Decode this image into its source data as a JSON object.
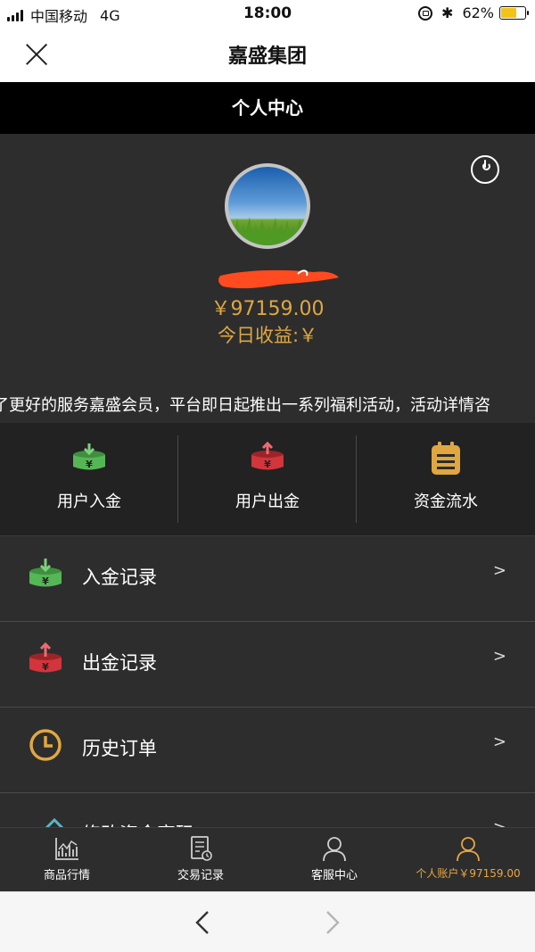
{
  "status_bar": {
    "carrier": "中国移动",
    "network": "4G",
    "time": "18:00",
    "battery": "62%",
    "battery_level": 0.62,
    "battery_color": "#f2c418"
  },
  "nav": {
    "title": "嘉盛集团",
    "close_icon": "close-icon"
  },
  "page_header": {
    "title": "个人中心"
  },
  "profile": {
    "balance": "￥97159.00",
    "today_earnings": "今日收益:￥",
    "accent_color": "#e0a740"
  },
  "announcement": "了更好的服务嘉盛会员，平台即日起推出一系列福利活动，活动详情咨",
  "actions": [
    {
      "label": "用户入金",
      "icon": "deposit-icon",
      "color": "#4fb04f"
    },
    {
      "label": "用户出金",
      "icon": "withdraw-icon",
      "color": "#d2353b"
    },
    {
      "label": "资金流水",
      "icon": "clipboard-icon",
      "color": "#e0a740"
    }
  ],
  "menu": [
    {
      "label": "入金记录",
      "chevron": ">",
      "icon": "deposit-icon"
    },
    {
      "label": "出金记录",
      "chevron": ">",
      "icon": "withdraw-icon"
    },
    {
      "label": "历史订单",
      "chevron": ">",
      "icon": "clock-icon"
    },
    {
      "label": "修改资金密码",
      "chevron": ">",
      "icon": "pencil-icon"
    }
  ],
  "tabs": [
    {
      "label": "商品行情",
      "icon": "chart-icon"
    },
    {
      "label": "交易记录",
      "icon": "document-icon"
    },
    {
      "label": "客服中心",
      "icon": "person-icon"
    },
    {
      "label": "个人账户￥97159.00",
      "icon": "person-icon",
      "active": true
    }
  ],
  "browser": {
    "back_icon": "chevron-left-icon",
    "forward_icon": "chevron-right-icon"
  }
}
